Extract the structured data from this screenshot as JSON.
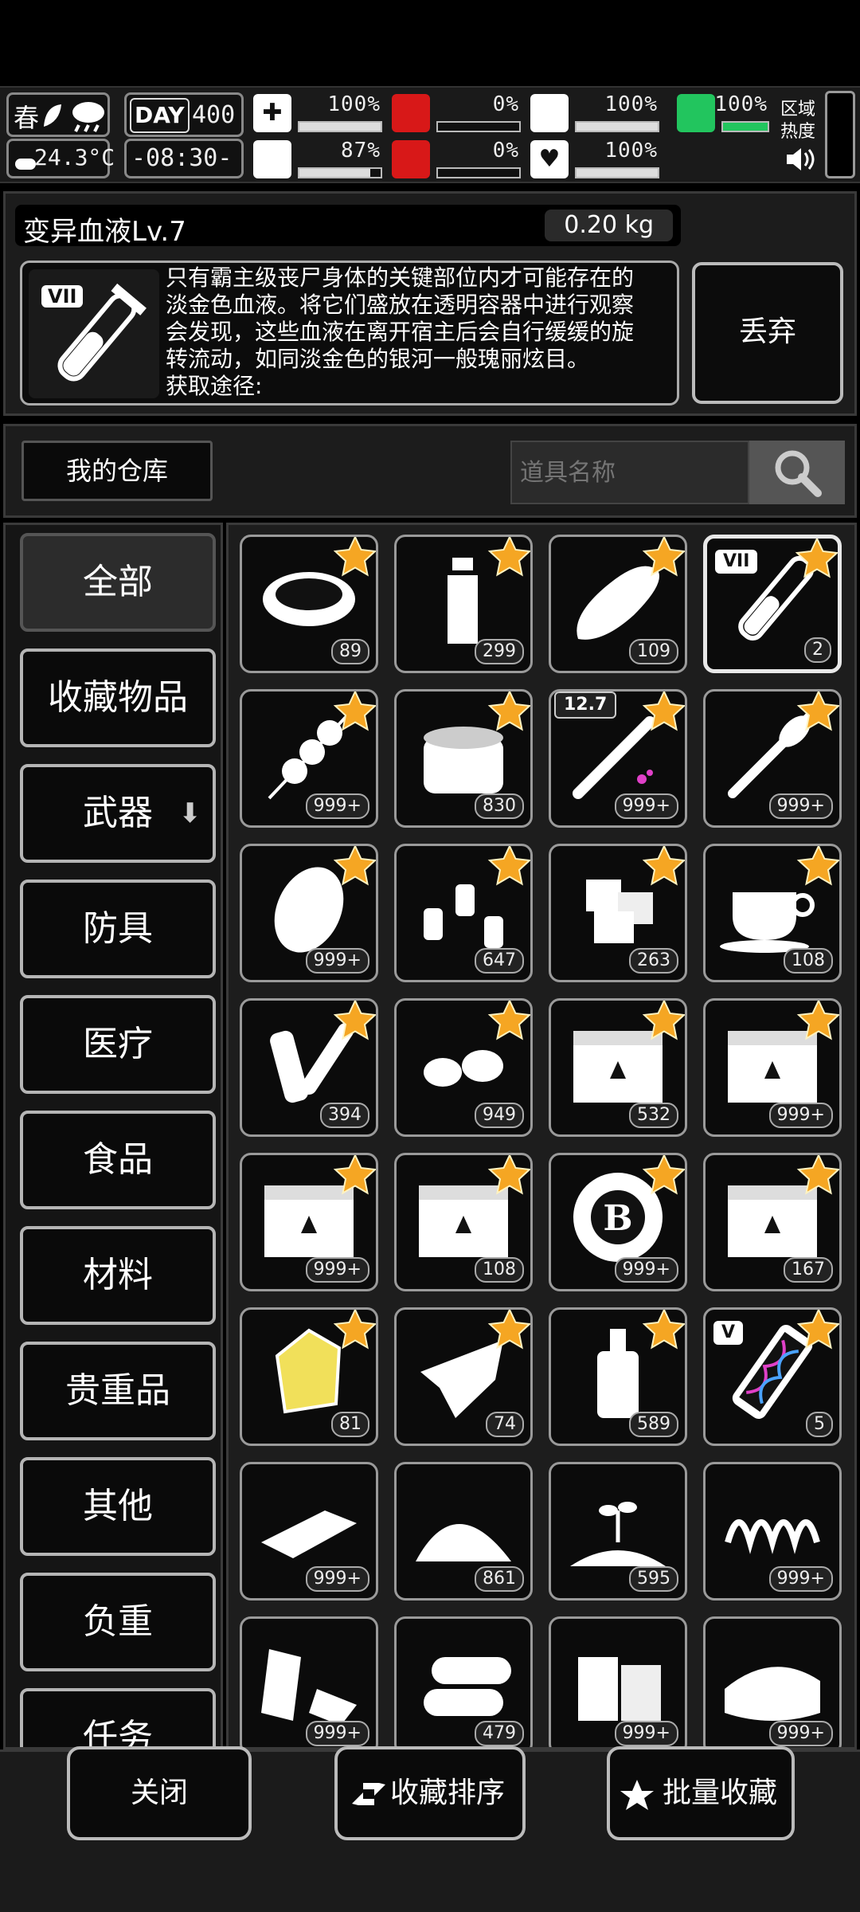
{
  "status": {
    "season": "春",
    "temperature": "24.3°C",
    "day_label": "DAY",
    "day": "400",
    "time": "-08:30-",
    "zone_label": "区域热度",
    "stats": [
      {
        "name": "health",
        "icon": "medkit-icon",
        "value": "100%",
        "level": 1.0
      },
      {
        "name": "hunger",
        "icon": "stomach-icon",
        "value": "0%",
        "level": 0.0
      },
      {
        "name": "hydration",
        "icon": "water-icon",
        "value": "100%",
        "level": 1.0
      },
      {
        "name": "stamina",
        "icon": "brain-icon",
        "value": "87%",
        "level": 0.87
      },
      {
        "name": "bleeding",
        "icon": "blood-drop-icon",
        "value": "0%",
        "level": 0.0
      },
      {
        "name": "mood",
        "icon": "heart-icon",
        "value": "100%",
        "level": 1.0
      },
      {
        "name": "boots",
        "icon": "boot-icon",
        "value": "100%",
        "level": 1.0
      }
    ]
  },
  "detail": {
    "item_name": "变异血液Lv.7",
    "weight": "0.20 kg",
    "desc_lines": [
      "只有霸主级丧尸身体的关键部位内才可能存在的",
      "淡金色血液。将它们盛放在透明容器中进行观察",
      "会发现，这些血液在离开宿主后会自行缓缓的旋",
      "转流动，如同淡金色的银河一般瑰丽炫目。",
      "获取途径:"
    ],
    "icon_badge": "VII",
    "discard_label": "丢弃"
  },
  "toolbar": {
    "storage_label": "我的仓库",
    "search_placeholder": "道具名称"
  },
  "categories": [
    "全部",
    "收藏物品",
    "武器",
    "防具",
    "医疗",
    "食品",
    "材料",
    "贵重品",
    "其他",
    "负重",
    "任务"
  ],
  "items": [
    {
      "icon": "soup-pot-icon",
      "count": "89",
      "fav": true
    },
    {
      "icon": "water-bottle-icon",
      "count": "299",
      "fav": true
    },
    {
      "icon": "bread-icon",
      "count": "109",
      "fav": true
    },
    {
      "icon": "blood-vial-icon",
      "count": "2",
      "fav": true,
      "badge": "VII",
      "selected": true
    },
    {
      "icon": "meat-skewer-icon",
      "count": "999+",
      "fav": true
    },
    {
      "icon": "canned-food-icon",
      "count": "830",
      "fav": true
    },
    {
      "icon": "syringe-icon",
      "count": "999+",
      "fav": true,
      "badge": "12.7"
    },
    {
      "icon": "rocket-icon",
      "count": "999+",
      "fav": true
    },
    {
      "icon": "potato-icon",
      "count": "999+",
      "fav": true
    },
    {
      "icon": "spice-bottles-icon",
      "count": "647",
      "fav": true
    },
    {
      "icon": "ice-cubes-icon",
      "count": "263",
      "fav": true
    },
    {
      "icon": "coffee-cup-icon",
      "count": "108",
      "fav": true
    },
    {
      "icon": "scroll-icon",
      "count": "394",
      "fav": true
    },
    {
      "icon": "seeds-icon",
      "count": "949",
      "fav": true
    },
    {
      "icon": "crate-icon",
      "count": "532",
      "fav": true
    },
    {
      "icon": "crate-icon",
      "count": "999+",
      "fav": true
    },
    {
      "icon": "crate-icon",
      "count": "999+",
      "fav": true
    },
    {
      "icon": "crate-icon",
      "count": "108",
      "fav": true
    },
    {
      "icon": "coin-chip-icon",
      "count": "999+",
      "fav": true
    },
    {
      "icon": "crate-icon",
      "count": "167",
      "fav": true
    },
    {
      "icon": "gold-ore-icon",
      "count": "81",
      "fav": true
    },
    {
      "icon": "torn-cloth-icon",
      "count": "74",
      "fav": true
    },
    {
      "icon": "liquor-bottle-icon",
      "count": "589",
      "fav": true
    },
    {
      "icon": "dna-vial-icon",
      "count": "5",
      "fav": true,
      "badge": "V"
    },
    {
      "icon": "metal-plate-icon",
      "count": "999+",
      "fav": false
    },
    {
      "icon": "powder-pile-icon",
      "count": "861",
      "fav": false
    },
    {
      "icon": "sprout-soil-icon",
      "count": "595",
      "fav": false
    },
    {
      "icon": "spring-icon",
      "count": "999+",
      "fav": false
    },
    {
      "icon": "scrap-metal-icon",
      "count": "999+",
      "fav": false
    },
    {
      "icon": "logs-icon",
      "count": "479",
      "fav": false
    },
    {
      "icon": "planks-icon",
      "count": "999+",
      "fav": false
    },
    {
      "icon": "cloth-stack-icon",
      "count": "999+",
      "fav": false
    }
  ],
  "bottom": {
    "close_label": "关闭",
    "sort_label": "收藏排序",
    "batch_label": "批量收藏"
  },
  "colors": {
    "star": "#f5a623",
    "bg": "#000000",
    "panel": "#1c1c1c"
  }
}
